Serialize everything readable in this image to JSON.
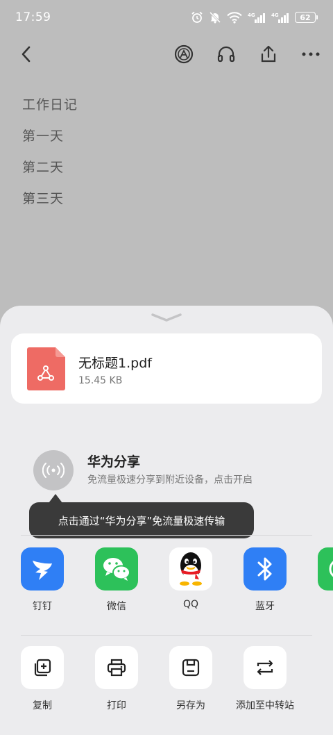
{
  "status_bar": {
    "time": "17:59",
    "battery": "62",
    "net1": "4G",
    "net2": "4G"
  },
  "note": {
    "lines": [
      "工作日记",
      "第一天",
      "第二天",
      "第三天"
    ]
  },
  "file": {
    "name": "无标题1.pdf",
    "size": "15.45 KB",
    "icon_color": "#ee6b64"
  },
  "huawei_share": {
    "title": "华为分享",
    "description": "免流量极速分享到附近设备，点击开启",
    "tooltip": "点击通过“华为分享”免流量极速传输"
  },
  "apps": [
    {
      "label": "钉钉",
      "icon": "dingtalk-icon",
      "color": "#2f7ff5"
    },
    {
      "label": "微信",
      "icon": "wechat-icon",
      "color": "#2dc15a"
    },
    {
      "label": "QQ",
      "icon": "qq-icon",
      "color": "#ffffff"
    },
    {
      "label": "蓝牙",
      "icon": "bluetooth-icon",
      "color": "#2f7ff5"
    },
    {
      "label": "",
      "icon": "partial-app-icon",
      "color": "#2dc15a"
    }
  ],
  "actions": [
    {
      "label": "复制",
      "icon": "copy-icon"
    },
    {
      "label": "打印",
      "icon": "print-icon"
    },
    {
      "label": "另存为",
      "icon": "save-icon"
    },
    {
      "label": "添加至中转站",
      "icon": "transfer-station-icon"
    }
  ]
}
